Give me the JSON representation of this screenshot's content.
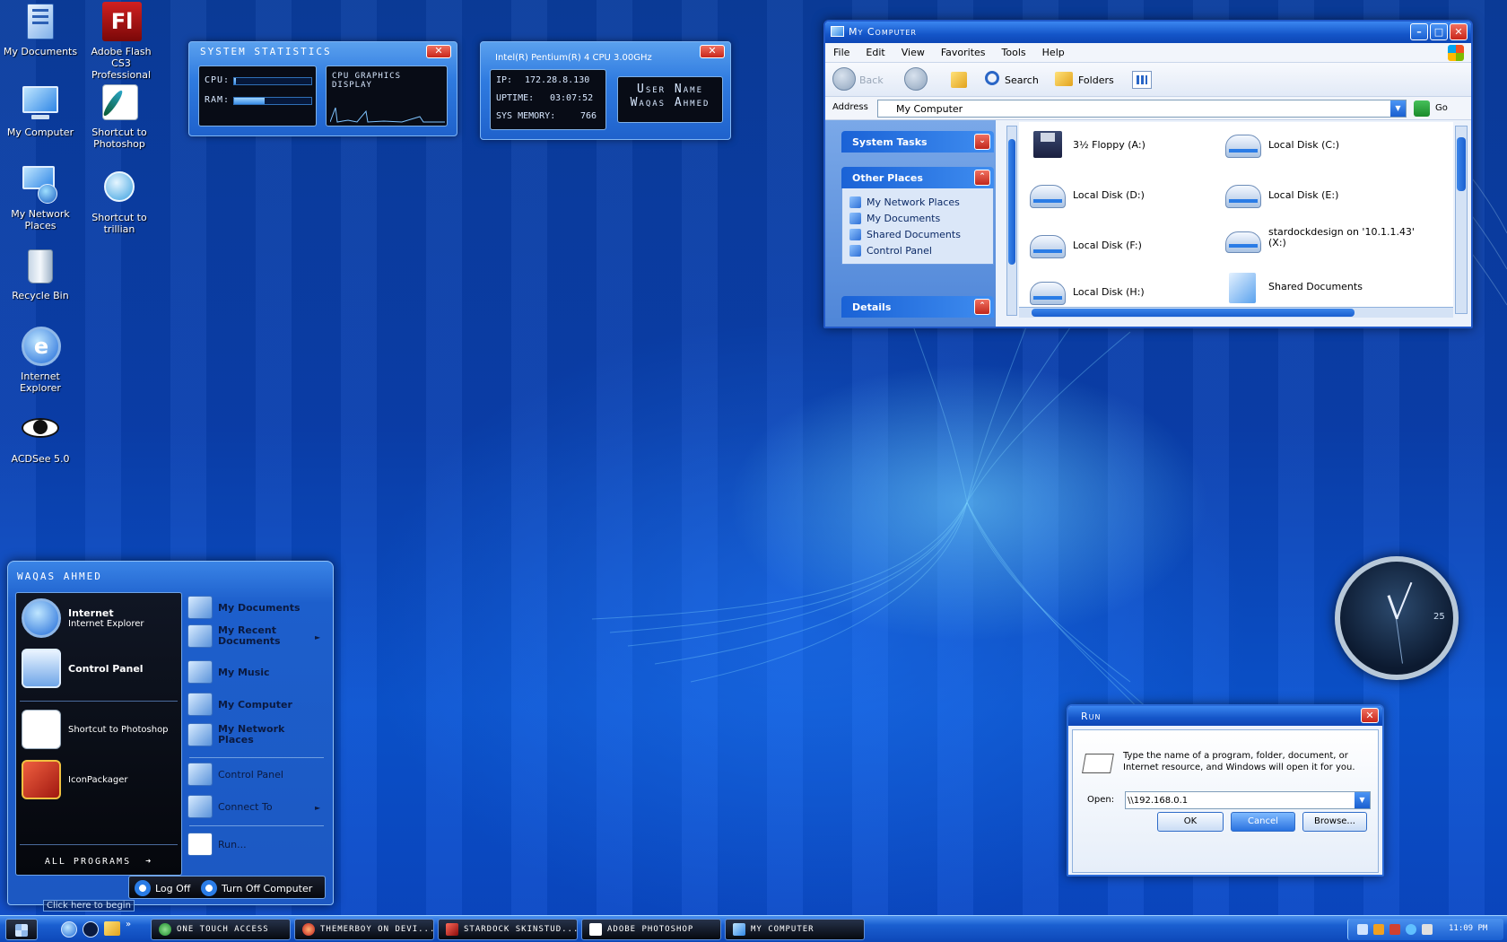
{
  "desktop_icons": [
    {
      "label": "My Documents",
      "icon": "my-documents-icon"
    },
    {
      "label": "Adobe Flash CS3 Professional",
      "icon": "flash-icon"
    },
    {
      "label": "My Computer",
      "icon": "my-computer-icon"
    },
    {
      "label": "Shortcut to Photoshop",
      "icon": "photoshop-icon"
    },
    {
      "label": "My Network Places",
      "icon": "network-icon"
    },
    {
      "label": "Shortcut to trillian",
      "icon": "trillian-icon"
    },
    {
      "label": "Recycle Bin",
      "icon": "recycle-bin-icon"
    },
    {
      "label": "Internet Explorer",
      "icon": "ie-icon"
    },
    {
      "label": "ACDSee 5.0",
      "icon": "acdsee-icon"
    }
  ],
  "flash_glyph": "Fl",
  "sys_stats": {
    "title": "System statistics",
    "cpu_label": "CPU:",
    "ram_label": "RAM:",
    "cpu_level": 0.02,
    "ram_level": 0.4,
    "graphics_title": "CPU GRAPHICS DISPLAY",
    "close": "✕"
  },
  "sysinfo": {
    "cpu_model": "Intel(R) Pentium(R) 4 CPU 3.00GHz",
    "ip_label": "IP:",
    "ip": "172.28.8.130",
    "uptime_label": "UPTIME:",
    "uptime": "03:07:52",
    "mem_label": "SYS MEMORY:",
    "mem": "766",
    "user_label": "User Name",
    "user_name": "Waqas Ahmed",
    "close": "✕"
  },
  "my_computer_window": {
    "title": "My Computer",
    "menu": [
      "File",
      "Edit",
      "View",
      "Favorites",
      "Tools",
      "Help"
    ],
    "toolbar": {
      "back": "Back",
      "search": "Search",
      "folders": "Folders"
    },
    "address_label": "Address",
    "address_value": "My Computer",
    "go_label": "Go",
    "system_tasks": "System Tasks",
    "other_places": "Other Places",
    "other_places_links": [
      "My Network Places",
      "My Documents",
      "Shared Documents",
      "Control Panel"
    ],
    "details": "Details",
    "drives": [
      {
        "name": "3½ Floppy (A:)"
      },
      {
        "name": "Local Disk (C:)"
      },
      {
        "name": "Local Disk (D:)"
      },
      {
        "name": "Local Disk (E:)"
      },
      {
        "name": "Local Disk (F:)"
      },
      {
        "name": "stardockdesign on '10.1.1.43'\n(X:)"
      },
      {
        "name": "Local Disk (H:)"
      },
      {
        "name": "Shared Documents"
      }
    ]
  },
  "start_menu": {
    "user": "Waqas Ahmed",
    "pinned": [
      {
        "title": "Internet",
        "subtitle": "Internet Explorer"
      },
      {
        "title": "Control Panel",
        "subtitle": ""
      }
    ],
    "recent": [
      "Shortcut to Photoshop",
      "IconPackager"
    ],
    "all_programs": "All Programs",
    "right_items": [
      {
        "label": "My Documents",
        "bold": true,
        "arrow": false
      },
      {
        "label": "My Recent Documents",
        "bold": true,
        "arrow": true
      },
      {
        "label": "My Music",
        "bold": true,
        "arrow": false
      },
      {
        "label": "My Computer",
        "bold": true,
        "arrow": false
      },
      {
        "label": "My Network Places",
        "bold": true,
        "arrow": false
      },
      {
        "label": "Control Panel",
        "bold": false,
        "arrow": false
      },
      {
        "label": "Connect To",
        "bold": false,
        "arrow": true
      },
      {
        "label": "Run...",
        "bold": false,
        "arrow": false
      }
    ],
    "log_off": "Log Off",
    "turn_off": "Turn Off Computer",
    "click_here": "Click here to begin"
  },
  "clock_widget": {
    "seconds": "25"
  },
  "run_dialog": {
    "title": "Run",
    "description": "Type the name of a program, folder, document, or Internet resource, and Windows will open it for you.",
    "open_label": "Open:",
    "open_value": "\\\\192.168.0.1",
    "ok": "OK",
    "cancel": "Cancel",
    "browse": "Browse..."
  },
  "taskbar": {
    "tasks": [
      "One Touch Access",
      "themerboy on devi...",
      "Stardock SkinStud...",
      "Adobe Photoshop",
      "My Computer"
    ],
    "clock": "11:09 PM"
  },
  "colors": {
    "accent": "#1a5fd0",
    "close_red": "#c8261a",
    "desktop_blue": "#0a3fae"
  }
}
